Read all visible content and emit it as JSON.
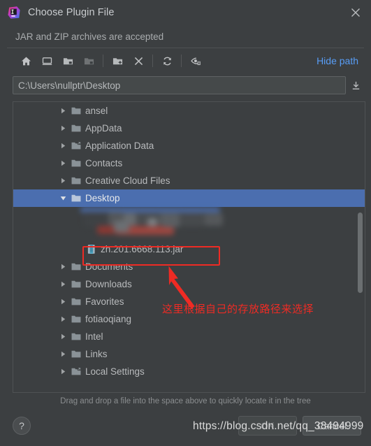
{
  "window": {
    "title": "Choose Plugin File",
    "subtitle": "JAR and ZIP archives are accepted",
    "app_icon": "intellij-idea-icon",
    "close_icon": "close-icon"
  },
  "toolbar": {
    "buttons": [
      {
        "name": "home-icon",
        "label": "Home",
        "enabled": true
      },
      {
        "name": "desktop-icon",
        "label": "Desktop",
        "enabled": true
      },
      {
        "name": "project-folder-icon",
        "label": "Project Directory",
        "enabled": true
      },
      {
        "name": "module-folder-icon",
        "label": "Module Directory",
        "enabled": false
      },
      {
        "name": "new-folder-icon",
        "label": "New Folder",
        "enabled": true
      },
      {
        "name": "delete-icon",
        "label": "Delete",
        "enabled": true
      },
      {
        "name": "refresh-icon",
        "label": "Refresh",
        "enabled": true
      },
      {
        "name": "show-hidden-files-icon",
        "label": "Show Hidden Files",
        "enabled": true
      }
    ],
    "hide_path_label": "Hide path"
  },
  "path": {
    "value": "C:\\Users\\nullptr\\Desktop",
    "placeholder": "",
    "expand_icon": "download-icon"
  },
  "tree": {
    "rows": [
      {
        "label": "ansel",
        "icon": "folder-icon",
        "twisty": "collapsed",
        "indent": 1,
        "selected": false,
        "kind": "folder"
      },
      {
        "label": "AppData",
        "icon": "folder-icon",
        "twisty": "collapsed",
        "indent": 1,
        "selected": false,
        "kind": "folder"
      },
      {
        "label": "Application Data",
        "icon": "folder-shortcut-icon",
        "twisty": "collapsed",
        "indent": 1,
        "selected": false,
        "kind": "folder"
      },
      {
        "label": "Contacts",
        "icon": "folder-icon",
        "twisty": "collapsed",
        "indent": 1,
        "selected": false,
        "kind": "folder"
      },
      {
        "label": "Creative Cloud Files",
        "icon": "folder-icon",
        "twisty": "collapsed",
        "indent": 1,
        "selected": false,
        "kind": "folder"
      },
      {
        "label": "Desktop",
        "icon": "folder-icon",
        "twisty": "expanded",
        "indent": 1,
        "selected": true,
        "kind": "folder"
      },
      {
        "label": "",
        "icon": "",
        "twisty": "none",
        "indent": 2,
        "selected": false,
        "kind": "redacted"
      },
      {
        "label": "zh.201.6668.113.jar",
        "icon": "jar-file-icon",
        "twisty": "none",
        "indent": 2,
        "selected": false,
        "kind": "file"
      },
      {
        "label": "Documents",
        "icon": "folder-icon",
        "twisty": "collapsed",
        "indent": 1,
        "selected": false,
        "kind": "folder"
      },
      {
        "label": "Downloads",
        "icon": "folder-icon",
        "twisty": "collapsed",
        "indent": 1,
        "selected": false,
        "kind": "folder"
      },
      {
        "label": "Favorites",
        "icon": "folder-icon",
        "twisty": "collapsed",
        "indent": 1,
        "selected": false,
        "kind": "folder"
      },
      {
        "label": "fotiaoqiang",
        "icon": "folder-icon",
        "twisty": "collapsed",
        "indent": 1,
        "selected": false,
        "kind": "folder"
      },
      {
        "label": "Intel",
        "icon": "folder-icon",
        "twisty": "collapsed",
        "indent": 1,
        "selected": false,
        "kind": "folder"
      },
      {
        "label": "Links",
        "icon": "folder-icon",
        "twisty": "collapsed",
        "indent": 1,
        "selected": false,
        "kind": "folder"
      },
      {
        "label": "Local Settings",
        "icon": "folder-shortcut-icon",
        "twisty": "collapsed",
        "indent": 1,
        "selected": false,
        "kind": "folder"
      }
    ],
    "scrollbar": {
      "thumb_top_pct": 38,
      "thumb_height_pct": 28
    }
  },
  "annotation": {
    "text": "这里根据自己的存放路径来选择",
    "color": "#ef2b24",
    "arrow": "up-left-arrow-icon",
    "highlight_target": "zh.201.6668.113.jar"
  },
  "footer": {
    "hint": "Drag and drop a file into the space above to quickly locate it in the tree",
    "help_label": "?",
    "ok_label": "OK",
    "cancel_label": "Cancel",
    "ok_enabled": false
  },
  "watermark": "https://blog.csdn.net/qq_38494999",
  "colors": {
    "background": "#3c3f41",
    "selection": "#4b6eaf",
    "link": "#589df6",
    "text": "#b8babc",
    "annotation_red": "#ef2b24",
    "folder": "#8a9297",
    "jar_blue": "#5b9bd5"
  }
}
